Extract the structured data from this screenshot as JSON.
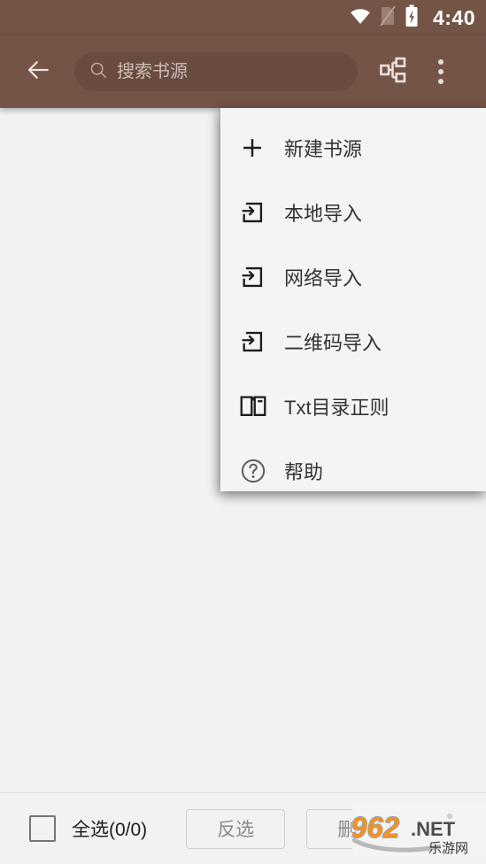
{
  "status_bar": {
    "time": "4:40",
    "icons": [
      "wifi-icon",
      "sim-card-off-icon",
      "battery-charging-icon"
    ]
  },
  "toolbar": {
    "back_icon": "arrow-left-icon",
    "search": {
      "placeholder": "搜索书源",
      "value": "",
      "icon": "search-icon"
    },
    "group_button": {
      "icon": "source-group-icon",
      "label": "分组"
    },
    "overflow_button": {
      "icon": "more-vertical-icon",
      "label": "更多"
    },
    "background_color": "#755448"
  },
  "popup_menu": {
    "items": [
      {
        "label": "新建书源",
        "icon": "plus-icon"
      },
      {
        "label": "本地导入",
        "icon": "import-arrow-icon"
      },
      {
        "label": "网络导入",
        "icon": "import-arrow-icon"
      },
      {
        "label": "二维码导入",
        "icon": "import-arrow-icon"
      },
      {
        "label": "Txt目录正则",
        "icon": "open-book-icon"
      },
      {
        "label": "帮助",
        "icon": "help-circle-icon"
      }
    ]
  },
  "bottom_bar": {
    "select_all_label": "全选(0/0)",
    "select_all_checked": false,
    "invert_label": "反选",
    "delete_label": "删除"
  },
  "watermark": {
    "number": "962",
    "domain": ".NET",
    "chinese": "乐游网",
    "number_color": "#f39322",
    "domain_color": "#4d4d4d"
  }
}
